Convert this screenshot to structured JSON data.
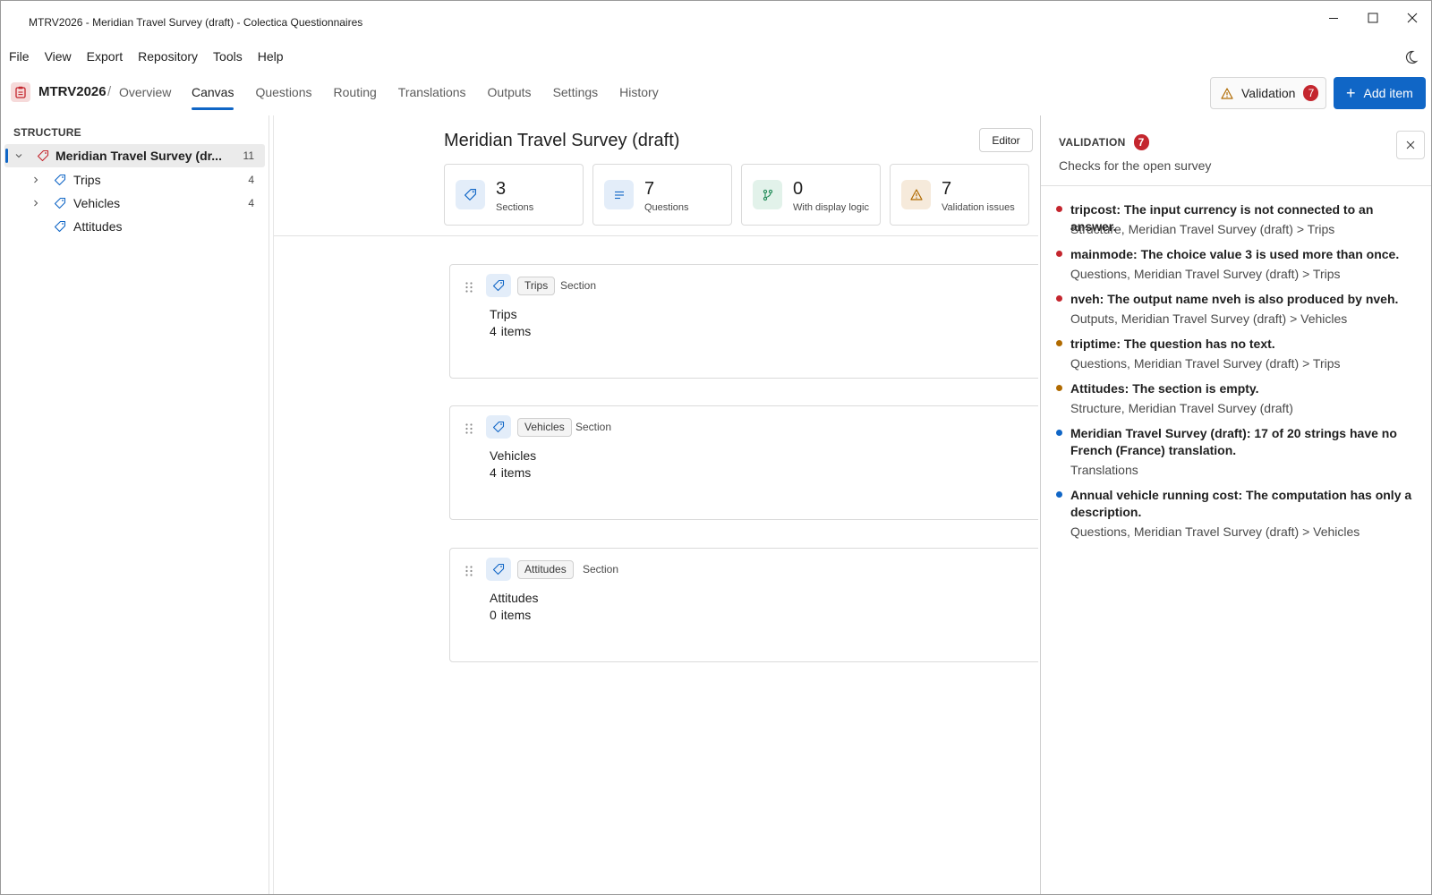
{
  "window": {
    "title": "MTRV2026 - Meridian Travel Survey (draft) - Colectica Questionnaires"
  },
  "menu": [
    "File",
    "View",
    "Export",
    "Repository",
    "Tools",
    "Help"
  ],
  "nav": {
    "brand": "MTRV2026",
    "separator": "/",
    "overview": "Overview",
    "tabs": [
      "Canvas",
      "Questions",
      "Routing",
      "Translations",
      "Outputs",
      "Settings",
      "History"
    ],
    "active_tab": "Canvas",
    "validation_label": "Validation",
    "validation_count": "7",
    "add_item_label": "Add item"
  },
  "sidebar": {
    "heading": "STRUCTURE",
    "root": {
      "label": "Meridian Travel Survey (dr...",
      "count": "11"
    },
    "items": [
      {
        "label": "Trips",
        "count": "4"
      },
      {
        "label": "Vehicles",
        "count": "4"
      },
      {
        "label": "Attitudes",
        "count": ""
      }
    ]
  },
  "main": {
    "title": "Meridian Travel Survey (draft)",
    "editor_label": "Editor",
    "stats": [
      {
        "value": "3",
        "label": "Sections",
        "icon": "tag-icon"
      },
      {
        "value": "7",
        "label": "Questions",
        "icon": "lines-icon"
      },
      {
        "value": "0",
        "label": "With display logic",
        "icon": "branch-icon"
      },
      {
        "value": "7",
        "label": "Validation issues",
        "icon": "warning-icon"
      }
    ],
    "sections": [
      {
        "chip": "Trips",
        "type": "Section",
        "name": "Trips",
        "count": "4",
        "items_word": "items"
      },
      {
        "chip": "Vehicles",
        "type": "Section",
        "name": "Vehicles",
        "count": "4",
        "items_word": "items"
      },
      {
        "chip": "Attitudes",
        "type": "Section",
        "name": "Attitudes",
        "count": "0",
        "items_word": "items"
      }
    ]
  },
  "validation": {
    "title": "VALIDATION",
    "count": "7",
    "subtitle": "Checks for the open survey",
    "issues": [
      {
        "severity": "error",
        "message": "tripcost: The input currency is not connected to an answer.",
        "location": "Structure, Meridian Travel Survey (draft) > Trips"
      },
      {
        "severity": "error",
        "message": "mainmode: The choice value 3 is used more than once.",
        "location": "Questions, Meridian Travel Survey (draft) > Trips"
      },
      {
        "severity": "error",
        "message": "nveh: The output name nveh is also produced by nveh.",
        "location": "Outputs, Meridian Travel Survey (draft) > Vehicles"
      },
      {
        "severity": "warning",
        "message": "triptime: The question has no text.",
        "location": "Questions, Meridian Travel Survey (draft) > Trips"
      },
      {
        "severity": "warning",
        "message": "Attitudes: The section is empty.",
        "location": "Structure, Meridian Travel Survey (draft)"
      },
      {
        "severity": "info",
        "message": "Meridian Travel Survey (draft): 17 of 20 strings have no French (France) translation.",
        "location": "Translations"
      },
      {
        "severity": "info",
        "message": "Annual vehicle running cost: The computation has only a description.",
        "location": "Questions, Meridian Travel Survey (draft) > Vehicles"
      }
    ]
  },
  "colors": {
    "accent": "#1066c6",
    "error": "#c4262e",
    "warning": "#b06a00",
    "info": "#1066c6"
  }
}
